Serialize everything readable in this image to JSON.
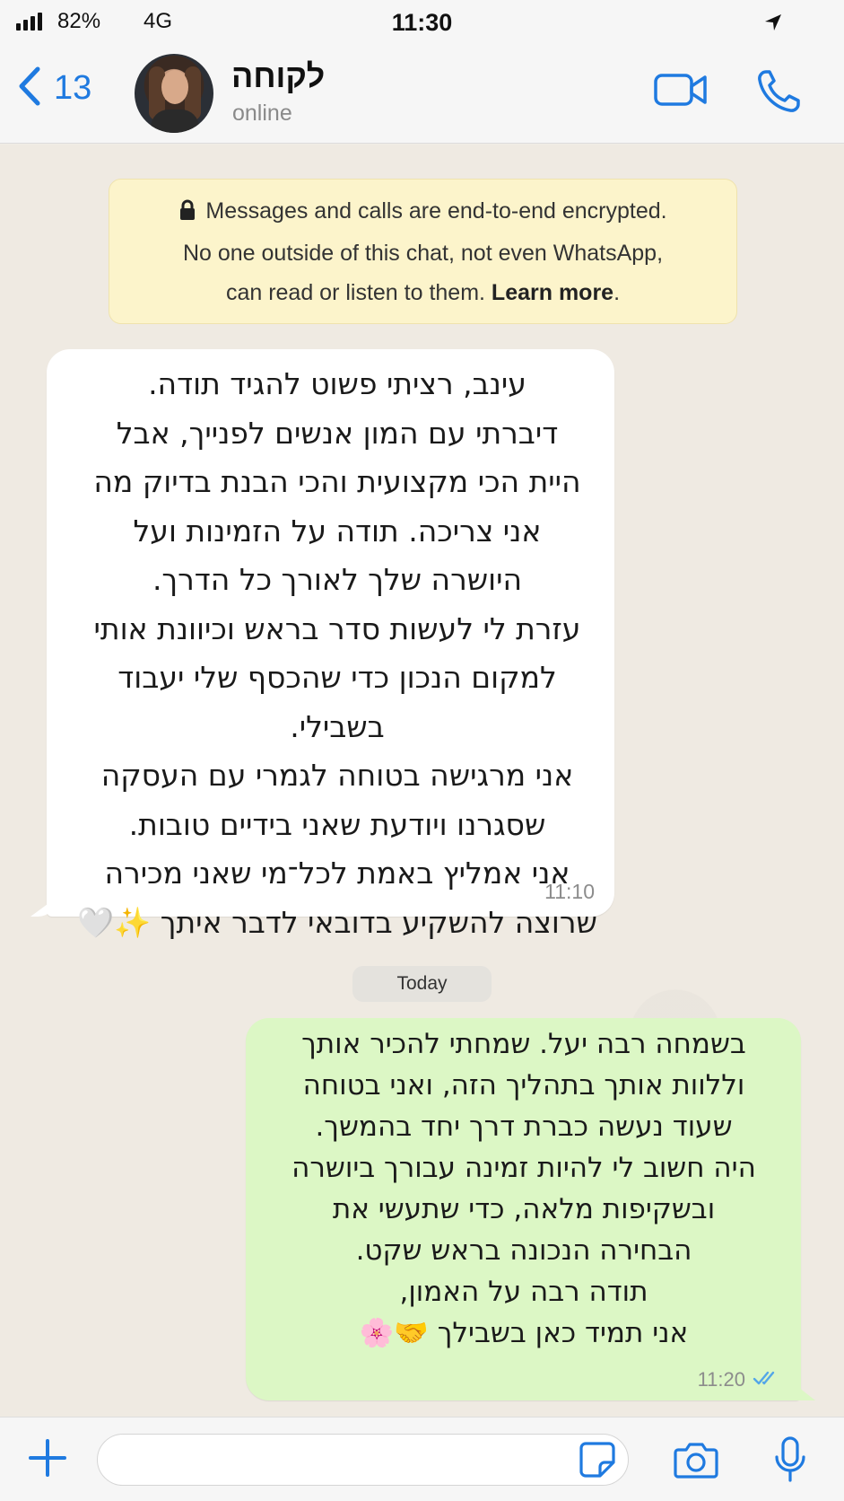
{
  "status_bar": {
    "battery": "82%",
    "network": "4G",
    "time": "11:30"
  },
  "header": {
    "back_count": "13",
    "contact_name": "לקוחה",
    "contact_status": "online"
  },
  "encryption": {
    "line1": "Messages and calls are end-to-end encrypted.",
    "line2": "No one outside of this chat, not even WhatsApp,",
    "line3_prefix": "can read or listen to them. ",
    "learn_more": "Learn more",
    "line3_suffix": "."
  },
  "messages": {
    "incoming": {
      "text": "עינב, רציתי פשוט להגיד תודה.\nדיברתי עם המון אנשים לפנייך, אבל\nהיית הכי מקצועית והכי הבנת בדיוק מה\nאני צריכה. תודה על הזמינות ועל\nהיושרה שלך לאורך כל הדרך.\nעזרת לי לעשות סדר בראש וכיוונת אותי\nלמקום הנכון כדי שהכסף שלי יעבוד בשבילי.\nאני מרגישה בטוחה לגמרי עם העסקה\nשסגרנו ויודעת שאני בידיים טובות.\nאני אמליץ באמת לכל־מי שאני מכירה\nשרוצה להשקיע בדובאי לדבר איתך ✨🤍",
      "time": "11:10"
    },
    "date_separator": "Today",
    "outgoing": {
      "text": "בשמחה רבה יעל. שמחתי להכיר אותך\nוללוות אותך בתהליך הזה, ואני בטוחה\nשעוד נעשה כברת דרך יחד בהמשך.\nהיה חשוב לי להיות זמינה עבורך ביושרה\nובשקיפות מלאה, כדי שתעשי את\nהבחירה הנכונה בראש שקט.\nתודה רבה על האמון,\nאני תמיד כאן בשבילך 🤝🌸",
      "time": "11:20",
      "status": "read"
    }
  },
  "input": {
    "value": "",
    "placeholder": ""
  },
  "colors": {
    "accent": "#1f7ae0",
    "outgoing_bubble": "#dcf7c5",
    "incoming_bubble": "#ffffff",
    "notice_bg": "#fcf4cb",
    "read_ticks": "#53a6e8"
  }
}
